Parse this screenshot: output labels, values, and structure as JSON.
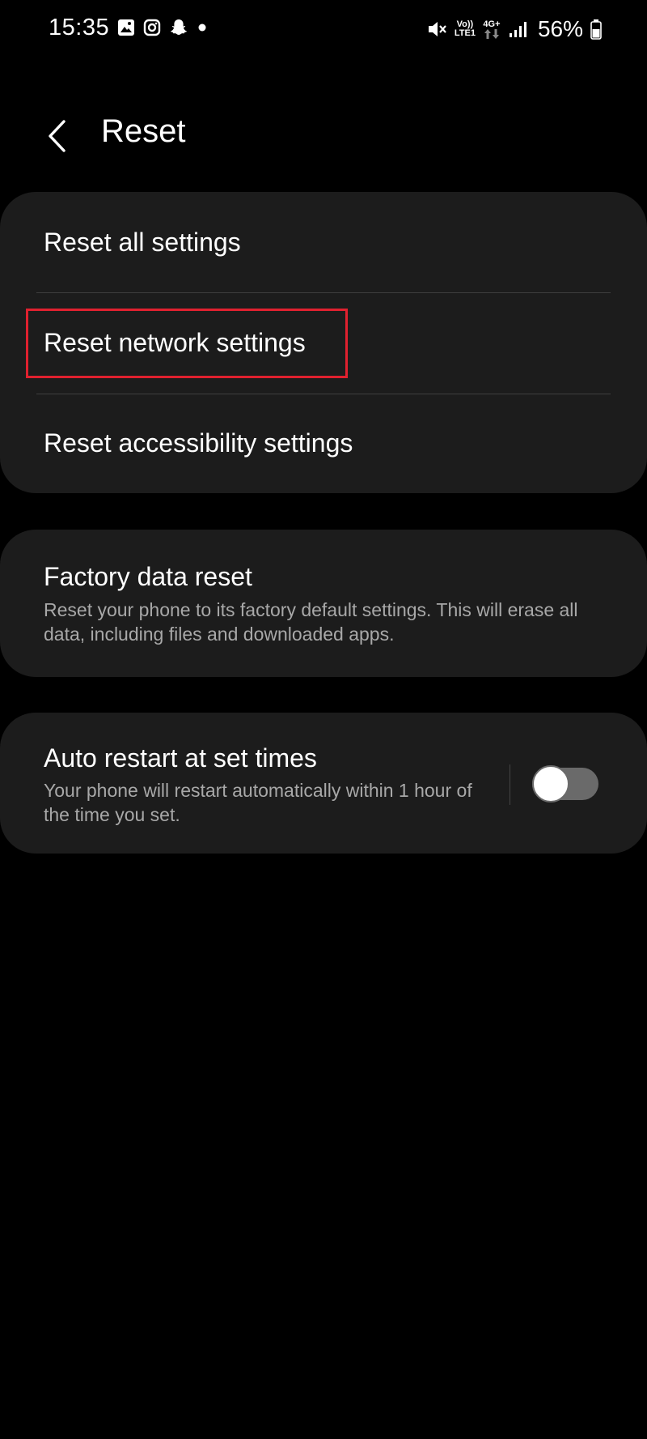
{
  "status_bar": {
    "time": "15:35",
    "left_icons": [
      "gallery-icon",
      "instagram-icon",
      "snapchat-icon",
      "dot-icon"
    ],
    "volte_line1": "Vo))",
    "volte_line2": "LTE1",
    "network_type": "4G+",
    "battery": "56%"
  },
  "header": {
    "title": "Reset"
  },
  "reset_options": {
    "items": [
      {
        "label": "Reset all settings"
      },
      {
        "label": "Reset network settings"
      },
      {
        "label": "Reset accessibility settings"
      }
    ],
    "highlight_color": "#e0212f"
  },
  "factory_reset": {
    "title": "Factory data reset",
    "description": "Reset your phone to its factory default settings. This will erase all data, including files and downloaded apps."
  },
  "auto_restart": {
    "title": "Auto restart at set times",
    "description": "Your phone will restart automatically within 1 hour of the time you set.",
    "enabled": false
  },
  "colors": {
    "background": "#000000",
    "card": "#1c1c1c",
    "secondary_text": "#a8a8a8"
  }
}
